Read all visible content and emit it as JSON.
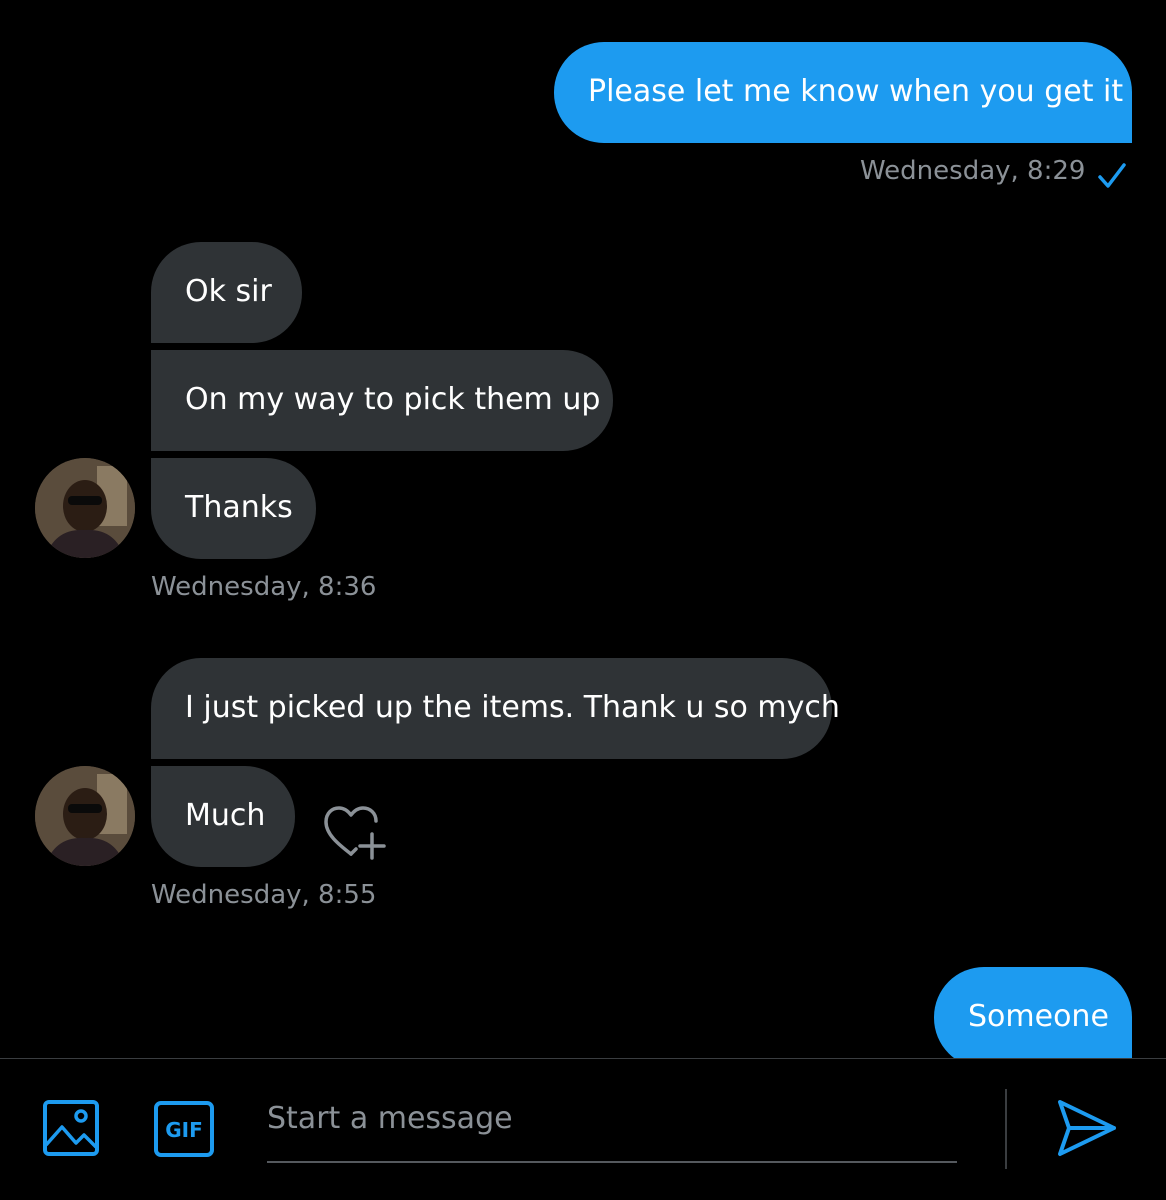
{
  "colors": {
    "accent": "#1d9bf0",
    "incoming_bubble": "#2f3336",
    "background": "#000000",
    "timestamp": "#8b9197"
  },
  "messages": {
    "m1": {
      "text": "Please let me know when you get it",
      "direction": "outgoing"
    },
    "m1_time": "Wednesday, 8:29",
    "m1_status_icon": "checkmark-icon",
    "m2": {
      "text": "Ok sir",
      "direction": "incoming"
    },
    "m3": {
      "text": "On my way to pick them up",
      "direction": "incoming"
    },
    "m4": {
      "text": "Thanks",
      "direction": "incoming"
    },
    "group1_time": "Wednesday, 8:36",
    "m5": {
      "text": "I just picked up the items. Thank u so mych",
      "direction": "incoming"
    },
    "m6": {
      "text": "Much",
      "direction": "incoming"
    },
    "group2_time": "Wednesday, 8:55",
    "m7": {
      "text": "Someone",
      "direction": "outgoing"
    }
  },
  "composer": {
    "placeholder": "Start a message",
    "media_icon": "image-icon",
    "gif_label": "GIF",
    "send_icon": "send-icon"
  },
  "reaction_icon": "heart-plus-icon"
}
